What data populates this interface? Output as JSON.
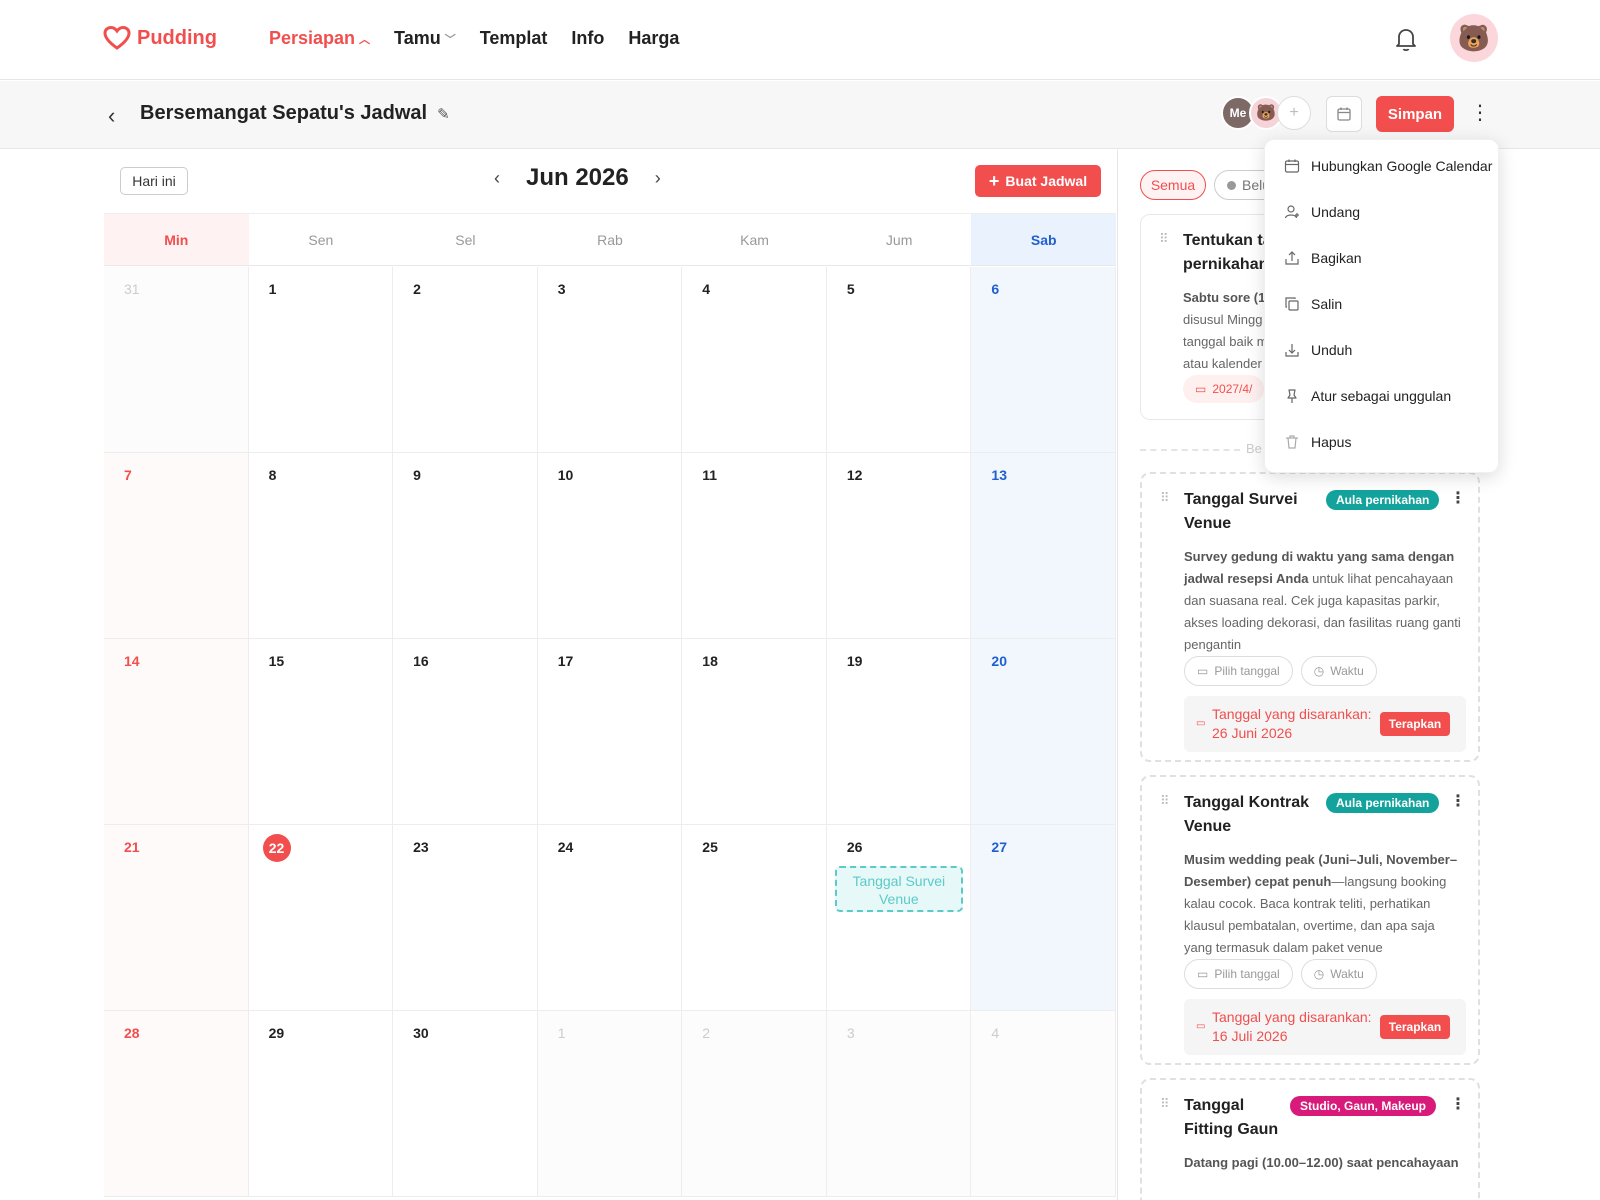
{
  "nav": {
    "brand": "Pudding",
    "items": [
      {
        "label": "Persiapan",
        "active": true,
        "has_caret": true
      },
      {
        "label": "Tamu",
        "active": false,
        "has_caret": true
      },
      {
        "label": "Templat",
        "active": false,
        "has_caret": false
      },
      {
        "label": "Info",
        "active": false,
        "has_caret": false
      },
      {
        "label": "Harga",
        "active": false,
        "has_caret": false
      }
    ]
  },
  "header": {
    "title": "Bersemangat Sepatu's Jadwal",
    "me_label": "Me",
    "add_label": "+",
    "save_label": "Simpan"
  },
  "calendar": {
    "today_label": "Hari ini",
    "month_title": "Jun 2026",
    "create_label": "Buat Jadwal",
    "weekdays": [
      "Min",
      "Sen",
      "Sel",
      "Rab",
      "Kam",
      "Jum",
      "Sab"
    ],
    "weeks": [
      [
        "31",
        "1",
        "2",
        "3",
        "4",
        "5",
        "6"
      ],
      [
        "7",
        "8",
        "9",
        "10",
        "11",
        "12",
        "13"
      ],
      [
        "14",
        "15",
        "16",
        "17",
        "18",
        "19",
        "20"
      ],
      [
        "21",
        "22",
        "23",
        "24",
        "25",
        "26",
        "27"
      ],
      [
        "28",
        "29",
        "30",
        "1",
        "2",
        "3",
        "4"
      ]
    ],
    "event": {
      "label": "Tanggal Survei Venue",
      "date": "26"
    }
  },
  "panel": {
    "filter_all": "Semua",
    "filter_pending": "Belu",
    "divider_text": "Be",
    "first_task": {
      "title_line1": "Tentukan ta",
      "title_line2": "pernikahan",
      "desc_bold": "Sabtu sore (1",
      "desc_lines": [
        "disusul Mingg",
        "tanggal baik m",
        "atau kalender"
      ],
      "date_chip": "2027/4/"
    },
    "tasks": [
      {
        "title": "Tanggal Survei Venue",
        "tag": "Aula pernikahan",
        "desc_bold": "Survey gedung di waktu yang sama dengan jadwal resepsi Anda",
        "desc_rest": " untuk lihat pencahayaan dan suasana real. Cek juga kapasitas parkir, akses loading dekorasi, dan fasilitas ruang ganti pengantin",
        "pick_date": "Pilih tanggal",
        "time": "Waktu",
        "suggest_label": "Tanggal yang disarankan:",
        "suggest_date": "26 Juni 2026",
        "apply": "Terapkan"
      },
      {
        "title": "Tanggal Kontrak Venue",
        "tag": "Aula pernikahan",
        "desc_bold": "Musim wedding peak (Juni–Juli, November–Desember) cepat penuh",
        "desc_rest": "—langsung booking kalau cocok. Baca kontrak teliti, perhatikan klausul pembatalan, overtime, dan apa saja yang termasuk dalam paket venue",
        "pick_date": "Pilih tanggal",
        "time": "Waktu",
        "suggest_label": "Tanggal yang disarankan:",
        "suggest_date": "16 Juli 2026",
        "apply": "Terapkan"
      },
      {
        "title": "Tanggal Fitting Gaun",
        "tag": "Studio, Gaun, Makeup",
        "desc_bold": "Datang pagi (10.00–12.00) saat pencahayaan"
      }
    ]
  },
  "menu": {
    "items": [
      {
        "label": "Hubungkan Google Calendar",
        "icon": "calendar-icon"
      },
      {
        "label": "Undang",
        "icon": "user-add-icon"
      },
      {
        "label": "Bagikan",
        "icon": "share-icon"
      },
      {
        "label": "Salin",
        "icon": "copy-icon"
      },
      {
        "label": "Unduh",
        "icon": "download-icon"
      },
      {
        "label": "Atur sebagai unggulan",
        "icon": "pin-icon"
      },
      {
        "label": "Hapus",
        "icon": "trash-icon"
      }
    ]
  },
  "colors": {
    "accent": "#f24e4e",
    "teal": "#13a39c",
    "pink": "#d81b7a",
    "sunday": "#f24e4e",
    "saturday": "#1f5fcf"
  }
}
